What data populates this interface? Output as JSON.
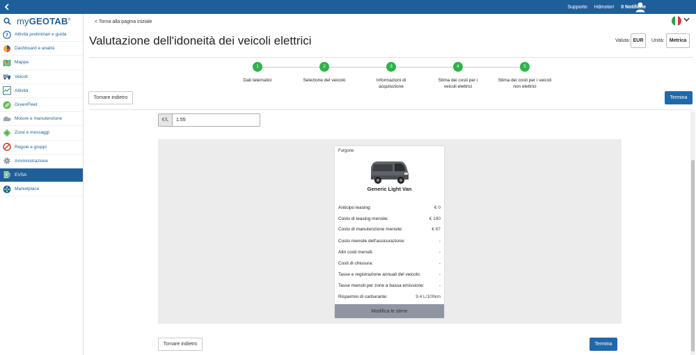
{
  "topbar": {
    "support": "Supporto",
    "user": "Hdmotori",
    "notifications": "0 Notifiche"
  },
  "sidebar": {
    "logo_my": "my",
    "logo_geotab": "GEOTAB",
    "logo_tm": "®",
    "items": [
      {
        "label": "Attività preliminari e guida",
        "icon": "question-icon"
      },
      {
        "label": "Dashboard e analisi",
        "icon": "pie-chart-icon"
      },
      {
        "label": "Mappa",
        "icon": "map-icon"
      },
      {
        "label": "Veicoli",
        "icon": "truck-icon"
      },
      {
        "label": "Attività",
        "icon": "activity-chart-icon"
      },
      {
        "label": "GreenFleet",
        "icon": "leaf-icon"
      },
      {
        "label": "Motore e manutenzione",
        "icon": "engine-icon"
      },
      {
        "label": "Zone e messaggi",
        "icon": "zone-icon"
      },
      {
        "label": "Regole e gruppi",
        "icon": "no-entry-icon"
      },
      {
        "label": "Amministrazione",
        "icon": "gear-icon"
      },
      {
        "label": "EVSA",
        "icon": "ev-icon",
        "active": true
      },
      {
        "label": "Marketplace",
        "icon": "marketplace-icon"
      }
    ]
  },
  "header": {
    "back_link": "< Torna alla pagina iniziale",
    "title": "Valutazione dell'idoneità dei veicoli elettrici",
    "currency_label": "Valuta:",
    "currency_value": "EUR",
    "unit_label": "Unità:",
    "unit_value": "Metrica"
  },
  "steps": [
    {
      "num": "1",
      "label": "Dati telematici"
    },
    {
      "num": "2",
      "label": "Selezione del veicolo"
    },
    {
      "num": "3",
      "label": "Informazioni di acquisizione"
    },
    {
      "num": "4",
      "label": "Stima dei costi per i veicoli elettrici"
    },
    {
      "num": "5",
      "label": "Stima dei costi per i veicoli non elettrici"
    }
  ],
  "buttons": {
    "back": "Tornare indietro",
    "finish": "Termina"
  },
  "fuel_price": {
    "unit": "€/L",
    "value": "1.55"
  },
  "vehicle_card": {
    "type": "Furgone",
    "name": "Generic Light Van",
    "rows": [
      {
        "label": "Anticipo leasing:",
        "value": "€ 0"
      },
      {
        "label": "Costo di leasing mensile:",
        "value": "€ 190"
      },
      {
        "label": "Costo di manutenzione mensile:",
        "value": "€ 87"
      },
      {
        "label": "Costo mensile dell'assicurazione:",
        "value": "-"
      },
      {
        "label": "Altri costi mensili:",
        "value": "-"
      },
      {
        "label": "Costi di chiusura:",
        "value": "-"
      },
      {
        "label": "Tasse e registrazione annuali del veicolo:",
        "value": "-"
      },
      {
        "label": "Tasse mensili per zone a bassa emissione:",
        "value": "-"
      },
      {
        "label": "Risparmio di carburante:",
        "value": "9.4 L/100km"
      }
    ],
    "edit_button": "Modifica le stime"
  },
  "colors": {
    "brand": "#1e5f99",
    "step_green": "#2db34a",
    "primary_button": "#2168aa"
  }
}
